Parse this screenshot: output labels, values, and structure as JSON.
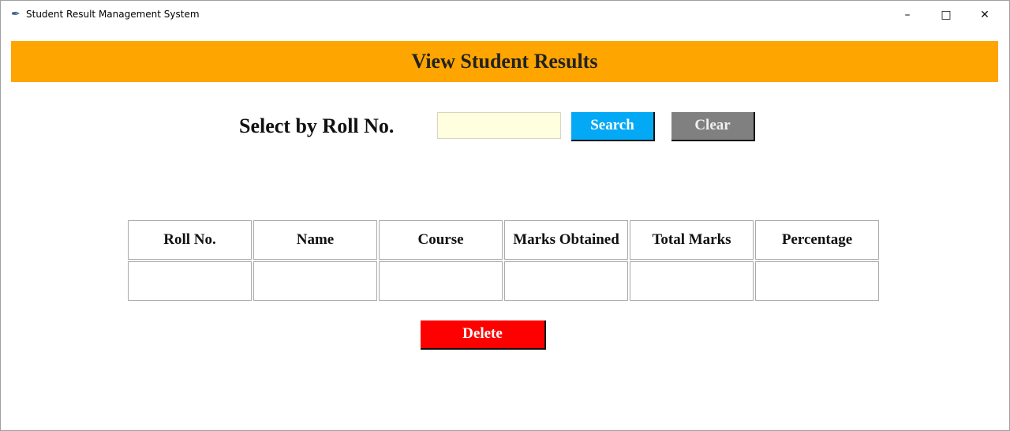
{
  "window": {
    "title": "Student Result Management System",
    "icon": "feather-icon",
    "controls": [
      "minimize",
      "maximize",
      "close"
    ]
  },
  "banner": {
    "title": "View Student Results",
    "color": "#ffa500"
  },
  "search": {
    "label": "Select by Roll No.",
    "value": "",
    "search_label": "Search",
    "clear_label": "Clear"
  },
  "table": {
    "headers": [
      "Roll No.",
      "Name",
      "Course",
      "Marks Obtained",
      "Total Marks",
      "Percentage"
    ],
    "rows": [
      [
        "",
        "",
        "",
        "",
        "",
        ""
      ]
    ]
  },
  "actions": {
    "delete_label": "Delete"
  }
}
